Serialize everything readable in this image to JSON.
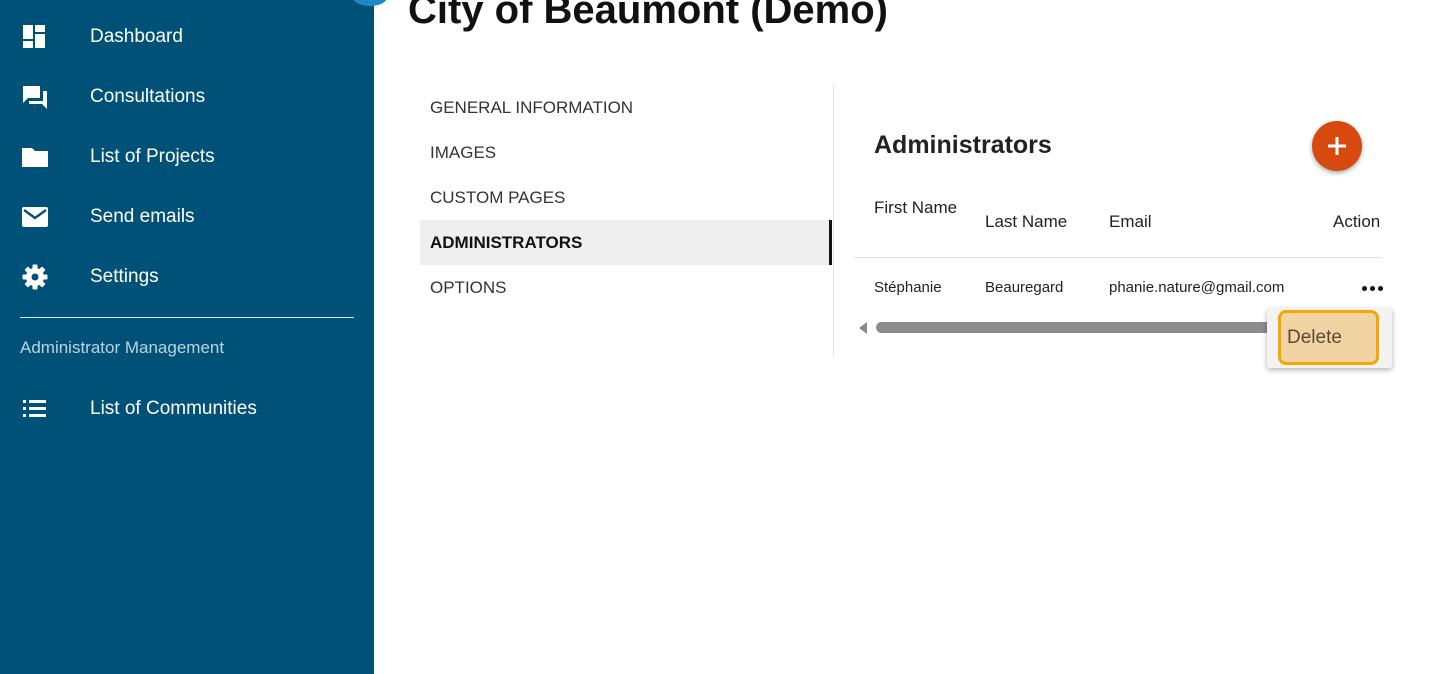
{
  "page": {
    "title": "City of Beaumont (Demo)"
  },
  "sidebar": {
    "items": [
      {
        "label": "Dashboard",
        "icon": "dashboard-icon"
      },
      {
        "label": "Consultations",
        "icon": "chat-icon"
      },
      {
        "label": "List of Projects",
        "icon": "folder-icon"
      },
      {
        "label": "Send emails",
        "icon": "mail-icon"
      },
      {
        "label": "Settings",
        "icon": "gear-icon"
      }
    ],
    "section_title": "Administrator Management",
    "section_items": [
      {
        "label": "List of Communities",
        "icon": "list-icon"
      }
    ]
  },
  "tabs": [
    {
      "label": "GENERAL INFORMATION",
      "active": false
    },
    {
      "label": "IMAGES",
      "active": false
    },
    {
      "label": "CUSTOM PAGES",
      "active": false
    },
    {
      "label": "ADMINISTRATORS",
      "active": true
    },
    {
      "label": "OPTIONS",
      "active": false
    }
  ],
  "admins": {
    "title": "Administrators",
    "add_icon": "plus-icon",
    "columns": [
      "First Name",
      "Last Name",
      "Email",
      "Action"
    ],
    "rows": [
      {
        "first_name": "Stéphanie",
        "last_name": "Beauregard",
        "email": "phanie.nature@gmail.com",
        "action_icon": "more-icon"
      }
    ],
    "menu": {
      "delete_label": "Delete"
    }
  },
  "colors": {
    "sidebar_bg": "#005177",
    "accent_add": "#d64a0f",
    "focus_outline": "#f5a700",
    "delete_bg": "#f2d3a3"
  }
}
